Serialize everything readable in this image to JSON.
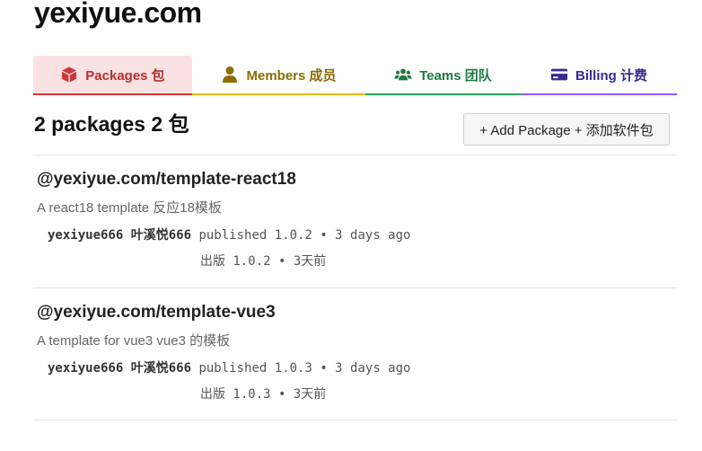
{
  "org": {
    "title": "yexiyue.com"
  },
  "tabs": [
    {
      "label": "Packages 包",
      "icon": "package-icon",
      "color": "#cb3837",
      "active": true
    },
    {
      "label": "Members 成员",
      "icon": "user-icon",
      "color": "#e6b800",
      "active": false
    },
    {
      "label": "Teams 团队",
      "icon": "users-icon",
      "color": "#27a35a",
      "active": false
    },
    {
      "label": "Billing 计费",
      "icon": "credit-card-icon",
      "color": "#8b5cf6",
      "active": false
    }
  ],
  "packages_section": {
    "heading": "2 packages 2 包",
    "add_button_label": "+ Add Package + 添加软件包"
  },
  "packages": [
    {
      "name": "@yexiyue.com/template-react18",
      "description": "A react18 template 反应18模板",
      "publisher": "yexiyue666 叶溪悦666",
      "published_text": "published 1.0.2 • 3 days ago",
      "published_text_cn": "出版 1.0.2 • 3天前"
    },
    {
      "name": "@yexiyue.com/template-vue3",
      "description": "A template for vue3 vue3 的模板",
      "publisher": "yexiyue666 叶溪悦666",
      "published_text": "published 1.0.3 • 3 days ago",
      "published_text_cn": "出版 1.0.3 • 3天前"
    }
  ]
}
